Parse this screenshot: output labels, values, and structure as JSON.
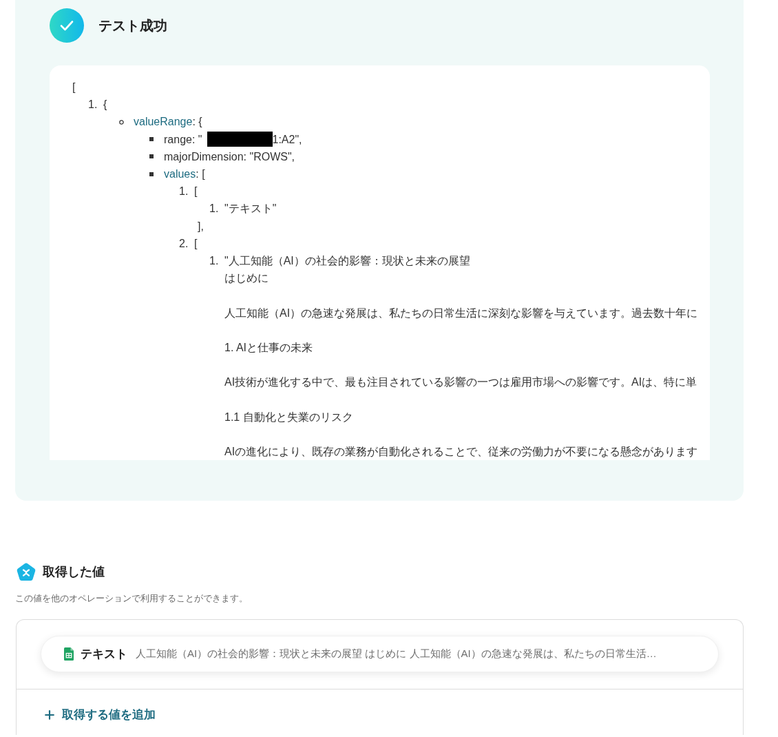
{
  "result": {
    "title": "テスト成功",
    "output": {
      "open": "[",
      "items": [
        {
          "kind": "number",
          "marker": "1.",
          "text": "{",
          "children": [
            {
              "kind": "circle",
              "key": "valueRange",
              "expandable": true,
              "text": ": {",
              "children": [
                {
                  "kind": "square",
                  "key": "range",
                  "expandable": false,
                  "text": ": \"",
                  "redacted": true,
                  "text_after": "1:A2\","
                },
                {
                  "kind": "square",
                  "key": "majorDimension",
                  "expandable": false,
                  "text": ": \"ROWS\","
                },
                {
                  "kind": "square",
                  "key": "values",
                  "expandable": true,
                  "text": ": [",
                  "children": [
                    {
                      "kind": "number",
                      "marker": "1.",
                      "text": "[",
                      "children": [
                        {
                          "kind": "number",
                          "marker": "1.",
                          "text": "\"テキスト\""
                        }
                      ],
                      "close": "],"
                    },
                    {
                      "kind": "number",
                      "marker": "2.",
                      "text": "[",
                      "children": [
                        {
                          "kind": "number",
                          "marker": "1.",
                          "paragraphs": [
                            [
                              "\"人工知能（AI）の社会的影響：現状と未来の展望",
                              "はじめに"
                            ],
                            [
                              "人工知能（AI）の急速な発展は、私たちの日常生活に深刻な影響を与えています。過去数十年に"
                            ],
                            [
                              "1. AIと仕事の未来"
                            ],
                            [
                              "AI技術が進化する中で、最も注目されている影響の一つは雇用市場への影響です。AIは、特に単"
                            ],
                            [
                              "1.1 自動化と失業のリスク"
                            ],
                            [
                              "AIの進化により、既存の業務が自動化されることで、従来の労働力が不要になる懸念があります"
                            ]
                          ]
                        }
                      ]
                    }
                  ]
                }
              ]
            }
          ]
        }
      ]
    }
  },
  "values_section": {
    "title": "取得した値",
    "description": "この値を他のオペレーションで利用することができます。",
    "items": [
      {
        "label": "テキスト",
        "value": "人工知能（AI）の社会的影響：現状と未来の展望 はじめに 人工知能（AI）の急速な発展は、私たちの日常生活…"
      }
    ],
    "add_button": "取得する値を追加"
  }
}
